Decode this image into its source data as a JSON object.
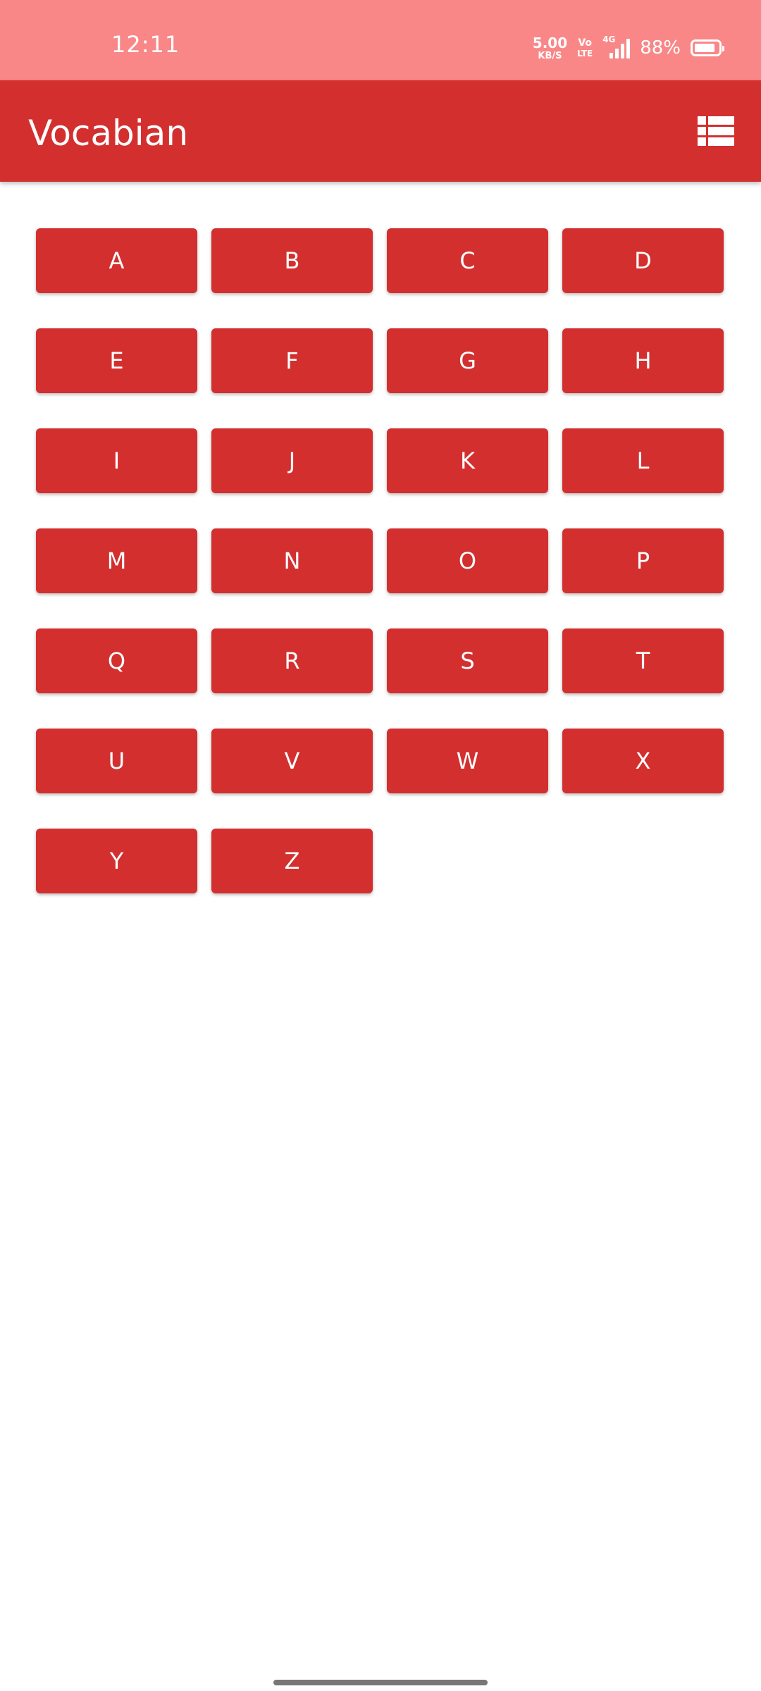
{
  "status_bar": {
    "time": "12:11",
    "net_speed_value": "5.00",
    "net_speed_unit": "KB/S",
    "volte_top": "Vo",
    "volte_bottom": "LTE",
    "network_type": "4G",
    "battery_percent": "88%",
    "battery_level": 0.88,
    "background_color": "#f98787"
  },
  "app_bar": {
    "title": "Vocabian",
    "action_icon": "view-list-icon",
    "color": "#d32f2f"
  },
  "letters": [
    "A",
    "B",
    "C",
    "D",
    "E",
    "F",
    "G",
    "H",
    "I",
    "J",
    "K",
    "L",
    "M",
    "N",
    "O",
    "P",
    "Q",
    "R",
    "S",
    "T",
    "U",
    "V",
    "W",
    "X",
    "Y",
    "Z"
  ],
  "colors": {
    "button": "#d32f2f",
    "button_text": "#ffffff",
    "background": "#ffffff"
  }
}
